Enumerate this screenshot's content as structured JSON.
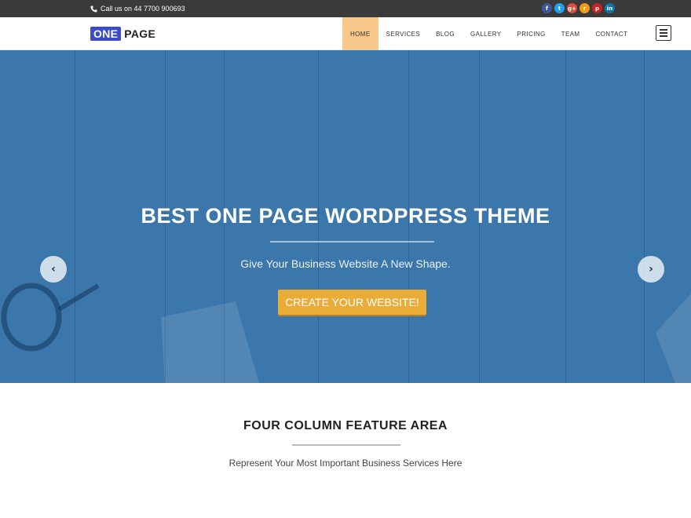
{
  "topbar": {
    "phone_text": "Call us on 44 7700 900693",
    "phone_icon": "phone-icon",
    "social": [
      {
        "name": "facebook-icon",
        "glyph": "f",
        "color": "#3b5998"
      },
      {
        "name": "twitter-icon",
        "glyph": "t",
        "color": "#1da1f2"
      },
      {
        "name": "google-plus-icon",
        "glyph": "g+",
        "color": "#dd4b39"
      },
      {
        "name": "rss-icon",
        "glyph": "r",
        "color": "#f39c12"
      },
      {
        "name": "pinterest-icon",
        "glyph": "p",
        "color": "#cb2027"
      },
      {
        "name": "linkedin-icon",
        "glyph": "in",
        "color": "#0e76a8"
      }
    ]
  },
  "header": {
    "logo_one": "ONE",
    "logo_page": "PAGE",
    "nav": [
      {
        "label": "HOME",
        "active": true
      },
      {
        "label": "SERVICES",
        "active": false
      },
      {
        "label": "BLOG",
        "active": false
      },
      {
        "label": "GALLERY",
        "active": false
      },
      {
        "label": "PRICING",
        "active": false
      },
      {
        "label": "TEAM",
        "active": false
      },
      {
        "label": "CONTACT",
        "active": false
      }
    ],
    "menu_icon": "hamburger-menu-icon"
  },
  "hero": {
    "title": "BEST ONE PAGE WORDPRESS THEME",
    "subtitle": "Give Your Business Website A New Shape.",
    "cta_label": "CREATE YOUR WEBSITE!",
    "prev_glyph": "‹",
    "next_glyph": "›"
  },
  "features": {
    "title": "FOUR COLUMN FEATURE AREA",
    "subtitle": "Represent Your Most Important Business Services Here"
  },
  "colors": {
    "topbar": "#3a3a3a",
    "logo_accent": "#3d4bc4",
    "nav_active": "#f8c78a",
    "hero_bg": "#3b77ab",
    "cta": "#e8ac37"
  }
}
